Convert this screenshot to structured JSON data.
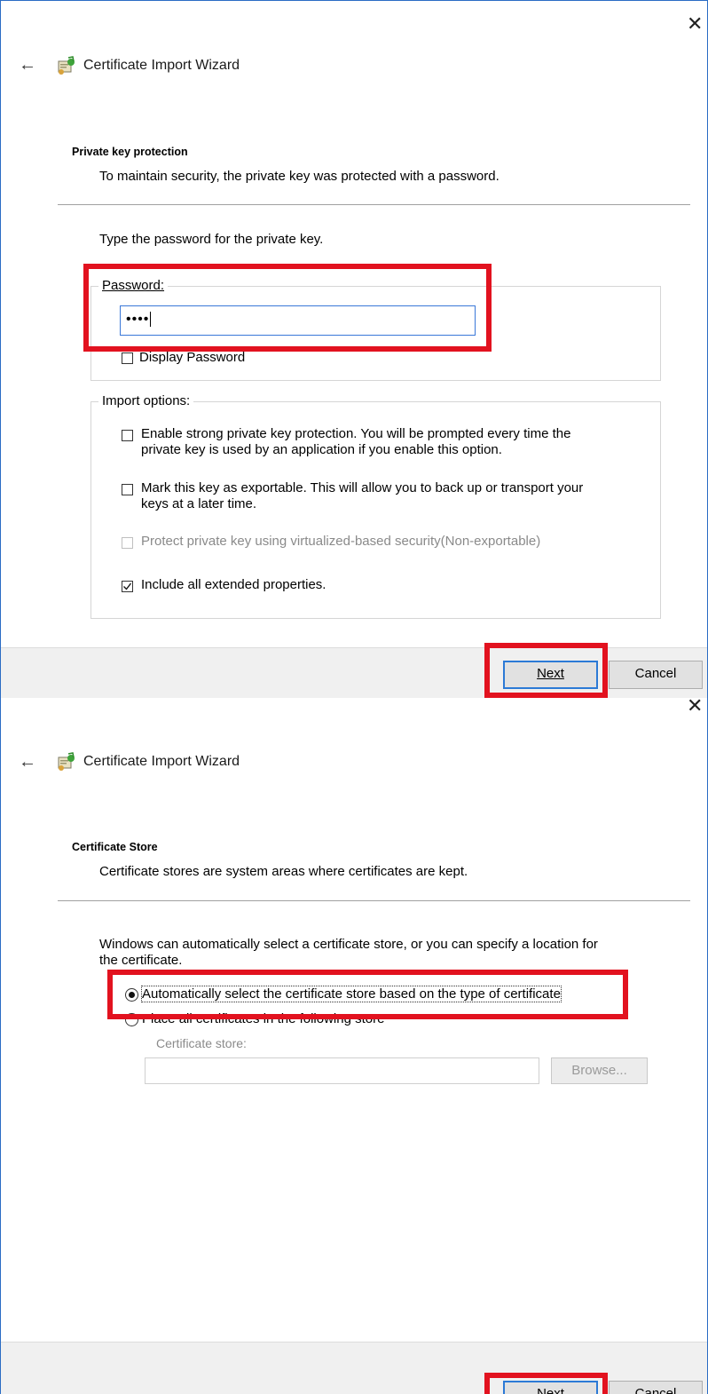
{
  "dialog1": {
    "close_glyph": "✕",
    "back_glyph": "←",
    "title": "Certificate Import Wizard",
    "heading": "Private key protection",
    "subheading": "To maintain security, the private key was protected with a password.",
    "instruction": "Type the password for the private key.",
    "password_label": "Password:",
    "password_value": "••••",
    "display_password_label": "Display Password",
    "import_options_label": "Import options:",
    "options": [
      {
        "label_1": "Enable strong private key protection. You will be prompted every time the",
        "label_2": "private key is used by an application if you enable this option.",
        "checked": false
      },
      {
        "label_1": "Mark this key as exportable. This will allow you to back up or transport your",
        "label_2": "keys at a later time.",
        "checked": false
      },
      {
        "label_1": "Protect private key using virtualized-based security(Non-exportable)",
        "checked": false,
        "disabled": true
      },
      {
        "label_1": "Include all extended properties.",
        "checked": true
      }
    ],
    "next_label": "Next",
    "cancel_label": "Cancel"
  },
  "dialog2": {
    "close_glyph": "✕",
    "back_glyph": "←",
    "title": "Certificate Import Wizard",
    "heading": "Certificate Store",
    "subheading": "Certificate stores are system areas where certificates are kept.",
    "instruction_1": "Windows can automatically select a certificate store, or you can specify a location for",
    "instruction_2": "the certificate.",
    "radio_auto_label": "Automatically select the certificate store based on the type of certificate",
    "radio_place_label": "Place all certificates in the following store",
    "store_label": "Certificate store:",
    "store_value": "",
    "browse_label": "Browse...",
    "next_label": "Next",
    "cancel_label": "Cancel"
  },
  "colors": {
    "highlight": "#e2121f",
    "accent": "#2c7ad6",
    "footer_bg": "#f0f0f0"
  }
}
